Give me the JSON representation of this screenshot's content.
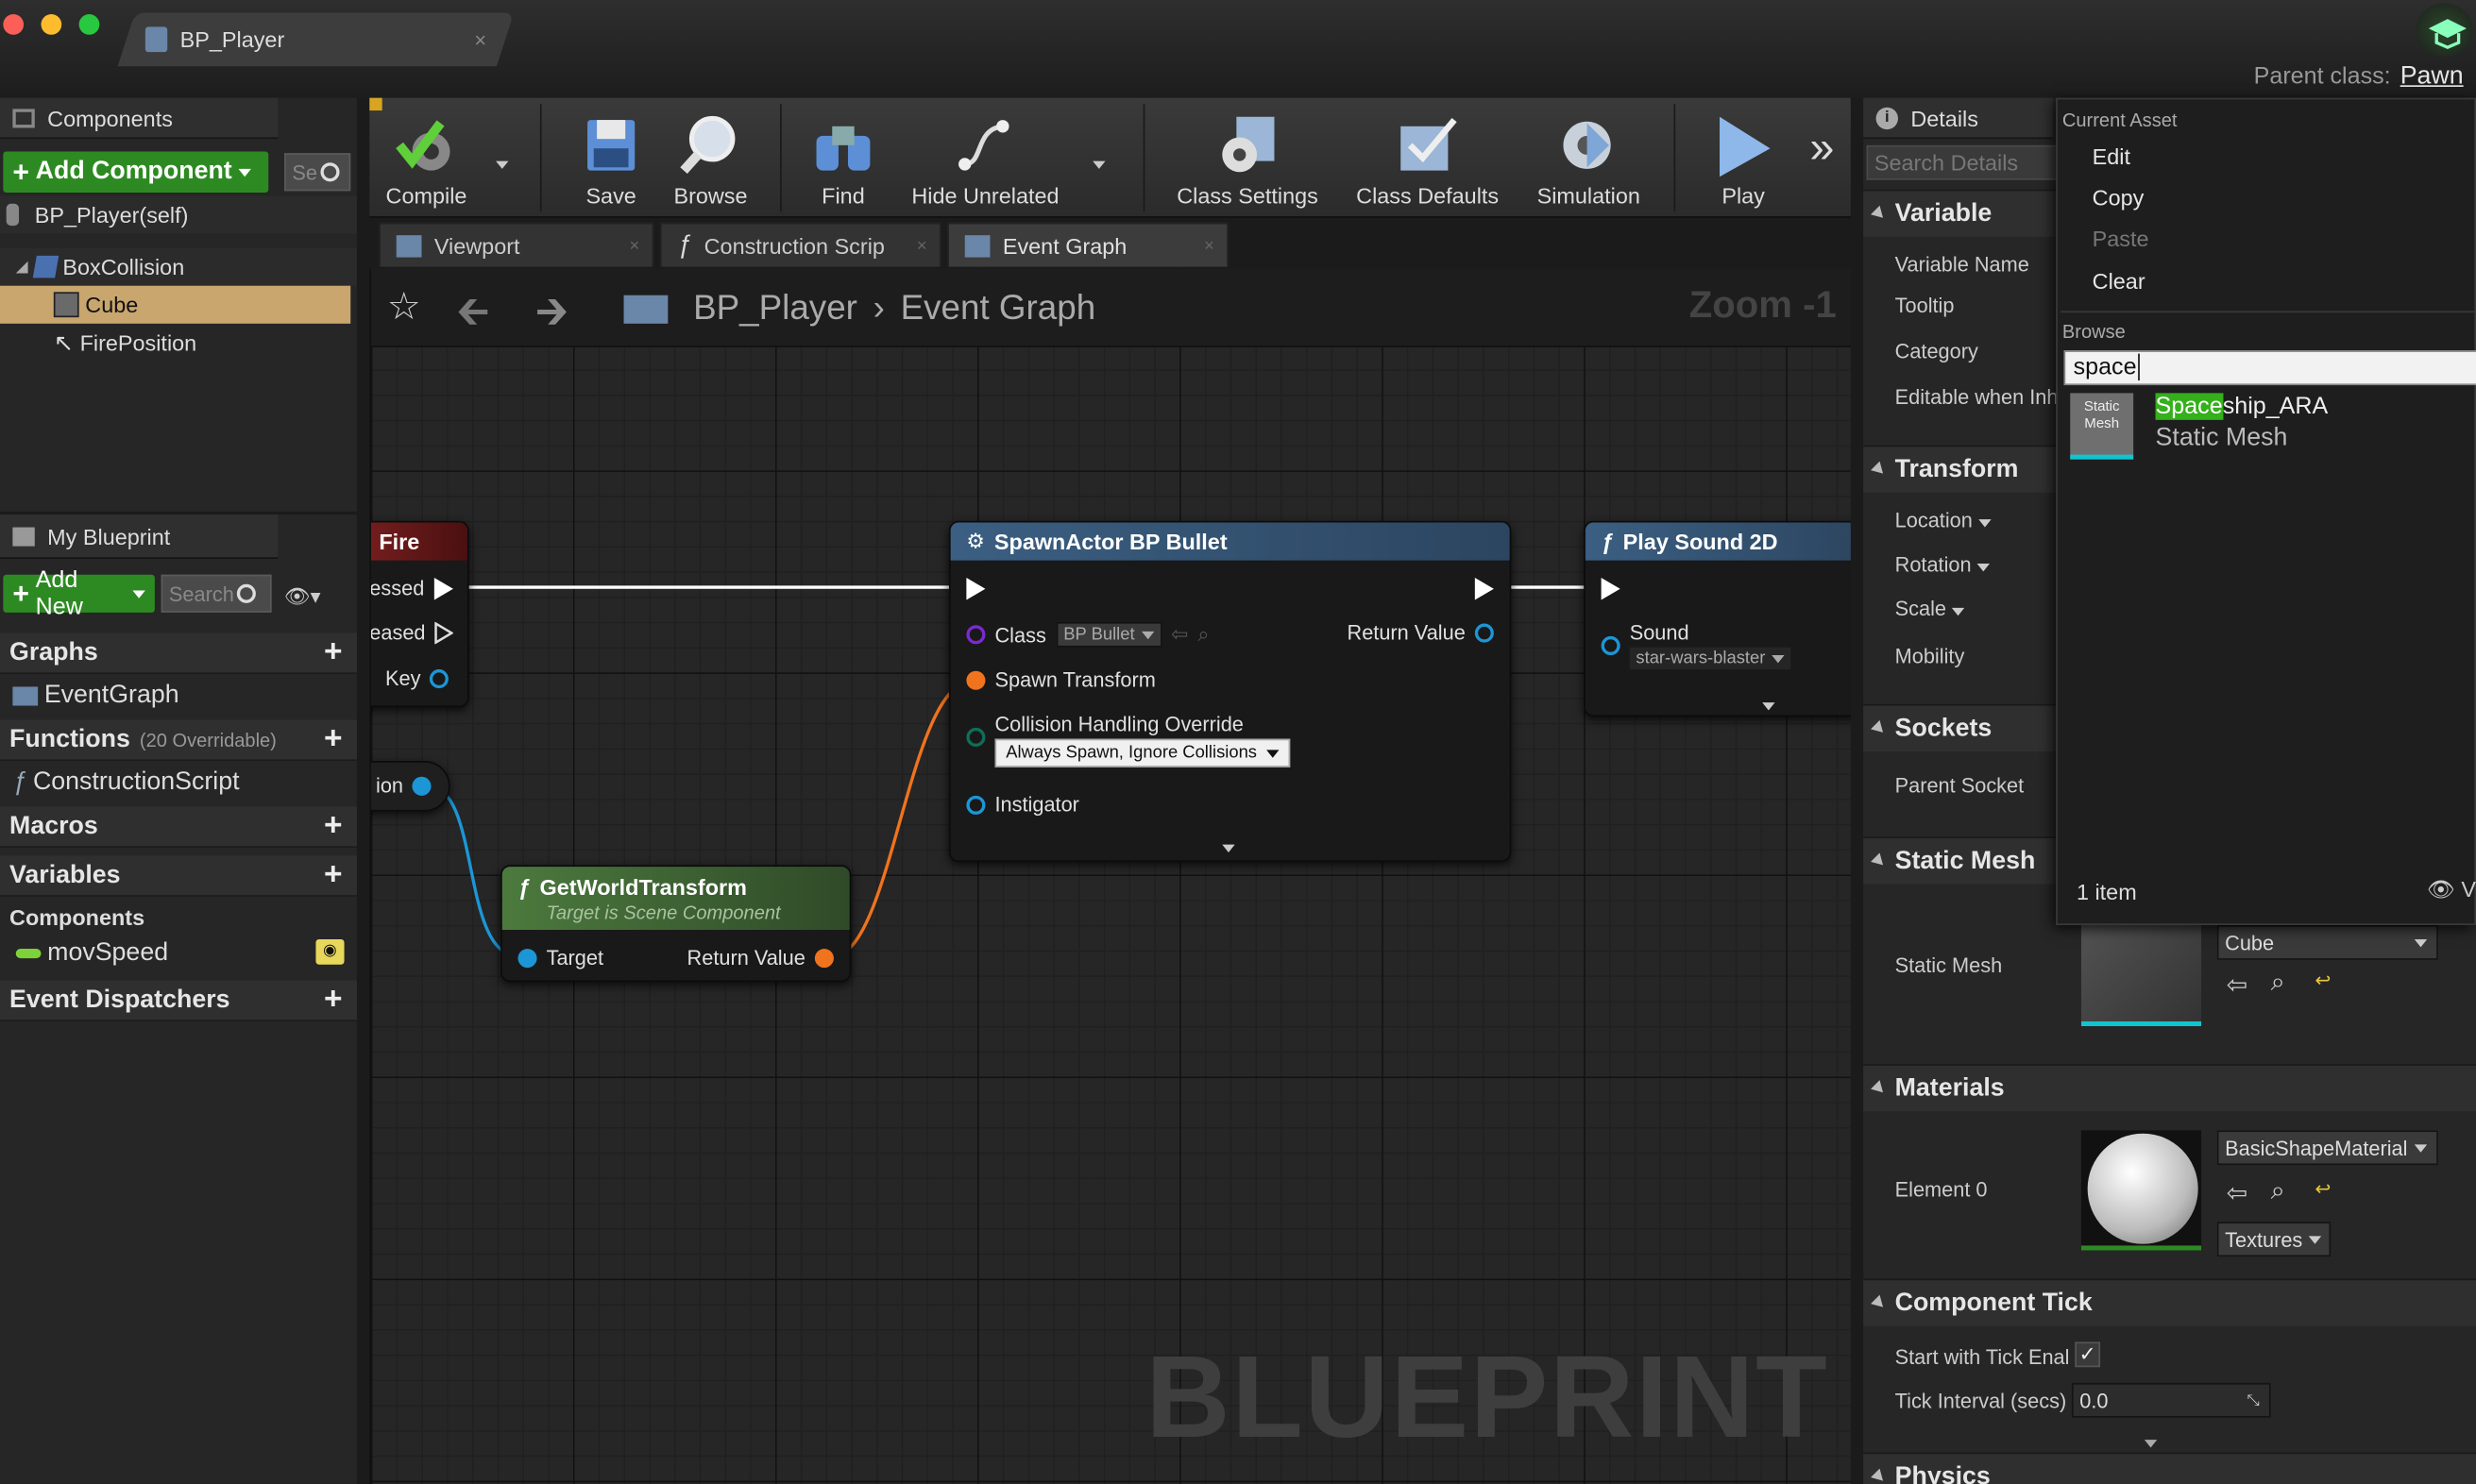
{
  "window": {
    "tab_title": "BP_Player",
    "tab_close": "×",
    "parent_class_label": "Parent class:",
    "parent_class_value": "Pawn"
  },
  "components_panel": {
    "title": "Components",
    "add_component_label": "Add Component",
    "search_placeholder": "Se",
    "self_item": "BP_Player(self)",
    "tree": [
      {
        "label": "BoxCollision",
        "selected": false
      },
      {
        "label": "Cube",
        "selected": true
      },
      {
        "label": "FirePosition",
        "selected": false
      }
    ]
  },
  "my_blueprint_panel": {
    "title": "My Blueprint",
    "add_new_label": "Add New",
    "search_placeholder": "Search",
    "sections": {
      "graphs": "Graphs",
      "event_graph": "EventGraph",
      "functions": "Functions",
      "functions_note": "(20 Overridable)",
      "construction_script": "ConstructionScript",
      "macros": "Macros",
      "variables": "Variables",
      "components": "Components",
      "mov_speed": "movSpeed",
      "event_dispatchers": "Event Dispatchers"
    }
  },
  "toolbar": {
    "compile": "Compile",
    "save": "Save",
    "browse": "Browse",
    "find": "Find",
    "hide_unrelated": "Hide Unrelated",
    "class_settings": "Class Settings",
    "class_defaults": "Class Defaults",
    "simulation": "Simulation",
    "play": "Play",
    "overflow": "»"
  },
  "graph_tabs": {
    "viewport": "Viewport",
    "construction": "Construction Scrip",
    "event_graph": "Event Graph"
  },
  "graph": {
    "breadcrumb_root": "BP_Player",
    "breadcrumb_current": "Event Graph",
    "zoom": "Zoom -1",
    "watermark": "BLUEPRINT",
    "fire_node": {
      "title": "Fire",
      "pressed": "essed",
      "released": "eased",
      "key": "Key"
    },
    "partial_node_label": "ion",
    "spawn_node": {
      "title": "SpawnActor BP Bullet",
      "class_label": "Class",
      "class_value": "BP Bullet",
      "return_value": "Return Value",
      "spawn_transform": "Spawn Transform",
      "collision_label": "Collision Handling Override",
      "collision_value": "Always Spawn, Ignore Collisions",
      "instigator": "Instigator"
    },
    "gwt_node": {
      "title": "GetWorldTransform",
      "subtitle": "Target is Scene Component",
      "target": "Target",
      "return_value": "Return Value"
    },
    "sound_node": {
      "title": "Play Sound 2D",
      "sound_label": "Sound",
      "sound_value": "star-wars-blaster"
    }
  },
  "details": {
    "title": "Details",
    "search_placeholder": "Search Details",
    "variable_cat": "Variable",
    "variable_name": "Variable Name",
    "tooltip": "Tooltip",
    "category": "Category",
    "editable": "Editable when Inhe",
    "transform_cat": "Transform",
    "location": "Location",
    "rotation": "Rotation",
    "scale": "Scale",
    "mobility": "Mobility",
    "sockets_cat": "Sockets",
    "parent_socket": "Parent Socket",
    "static_mesh_cat": "Static Mesh",
    "static_mesh_label": "Static Mesh",
    "static_mesh_value": "Cube",
    "materials_cat": "Materials",
    "element0": "Element 0",
    "material_value": "BasicShapeMaterial",
    "textures": "Textures",
    "tick_cat": "Component Tick",
    "start_with_tick": "Start with Tick Enal",
    "tick_interval": "Tick Interval (secs)",
    "tick_interval_value": "0.0",
    "physics_cat": "Physics"
  },
  "asset_popup": {
    "current_asset_header": "Current Asset",
    "edit": "Edit",
    "copy": "Copy",
    "paste": "Paste",
    "clear": "Clear",
    "browse_header": "Browse",
    "search_value": "space",
    "result_highlight": "Space",
    "result_rest": "ship_ARA",
    "result_type": "Static Mesh",
    "thumb_label_1": "Static",
    "thumb_label_2": "Mesh",
    "item_count": "1 item",
    "view_label": "V"
  },
  "colors": {
    "accent_green": "#2d8a22",
    "selection_tan": "#c8a66e",
    "exec_blue_head": "#3b5f82",
    "pure_green_head": "#4c7a3e",
    "highlight": "#34b01b",
    "cyan": "#10c5d0"
  }
}
